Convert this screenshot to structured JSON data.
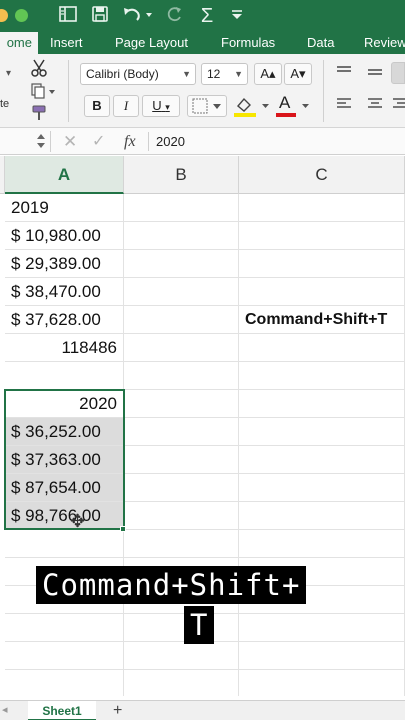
{
  "titlebar": {
    "icons": [
      "sidebar-icon",
      "save-icon",
      "undo-icon",
      "redo-icon",
      "autosum-icon",
      "customize-icon"
    ]
  },
  "tabs": [
    "ome",
    "Insert",
    "Page Layout",
    "Formulas",
    "Data",
    "Review"
  ],
  "ribbon": {
    "paste_label": "te",
    "font_name": "Calibri (Body)",
    "font_size": "12",
    "grow_font": "A▴",
    "shrink_font": "A▾",
    "bold": "B",
    "italic": "I",
    "underline": "U",
    "font_color_letter": "A",
    "highlight_color": "#f7e600",
    "font_color": "#d9141a"
  },
  "formula_bar": {
    "fx": "fx",
    "value": "2020"
  },
  "columns": [
    "A",
    "B",
    "C"
  ],
  "cells": {
    "a1": "2019",
    "a2": "$ 10,980.00",
    "a3": "$ 29,389.00",
    "a4": "$ 38,470.00",
    "a5": "$ 37,628.00",
    "a6": "118486",
    "a8": "2020",
    "a9": "$ 36,252.00",
    "a10": "$ 37,363.00",
    "a11": "$ 87,654.00",
    "a12": "$ 98,766.00",
    "c5": "Command+Shift+T"
  },
  "caption": {
    "line1": "Command+Shift+",
    "line2": "T"
  },
  "sheets": {
    "active": "Sheet1",
    "add": "+"
  },
  "accent_color": "#217346"
}
